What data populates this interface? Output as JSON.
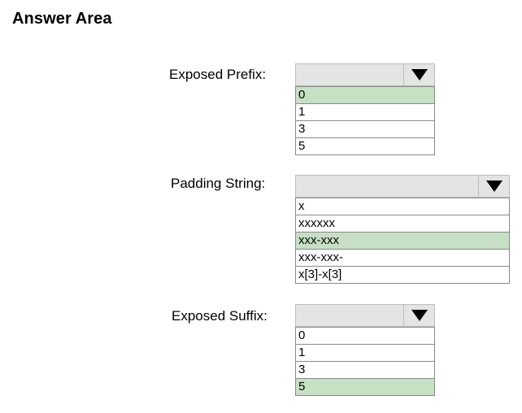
{
  "title": "Answer Area",
  "colors": {
    "selected_background": "#c6e0c3",
    "dropdown_header": "#e4e4e4"
  },
  "dropdowns": [
    {
      "label": "Exposed Prefix:",
      "arrow_icon": "triangle-down-icon",
      "options": [
        "0",
        "1",
        "3",
        "5"
      ],
      "selected": "0"
    },
    {
      "label": "Padding String:",
      "arrow_icon": "triangle-down-icon",
      "options": [
        "x",
        "xxxxxx",
        "xxx-xxx",
        "xxx-xxx-",
        "x[3]-x[3]"
      ],
      "selected": "xxx-xxx"
    },
    {
      "label": "Exposed Suffix:",
      "arrow_icon": "triangle-down-icon",
      "options": [
        "0",
        "1",
        "3",
        "5"
      ],
      "selected": "5"
    }
  ]
}
